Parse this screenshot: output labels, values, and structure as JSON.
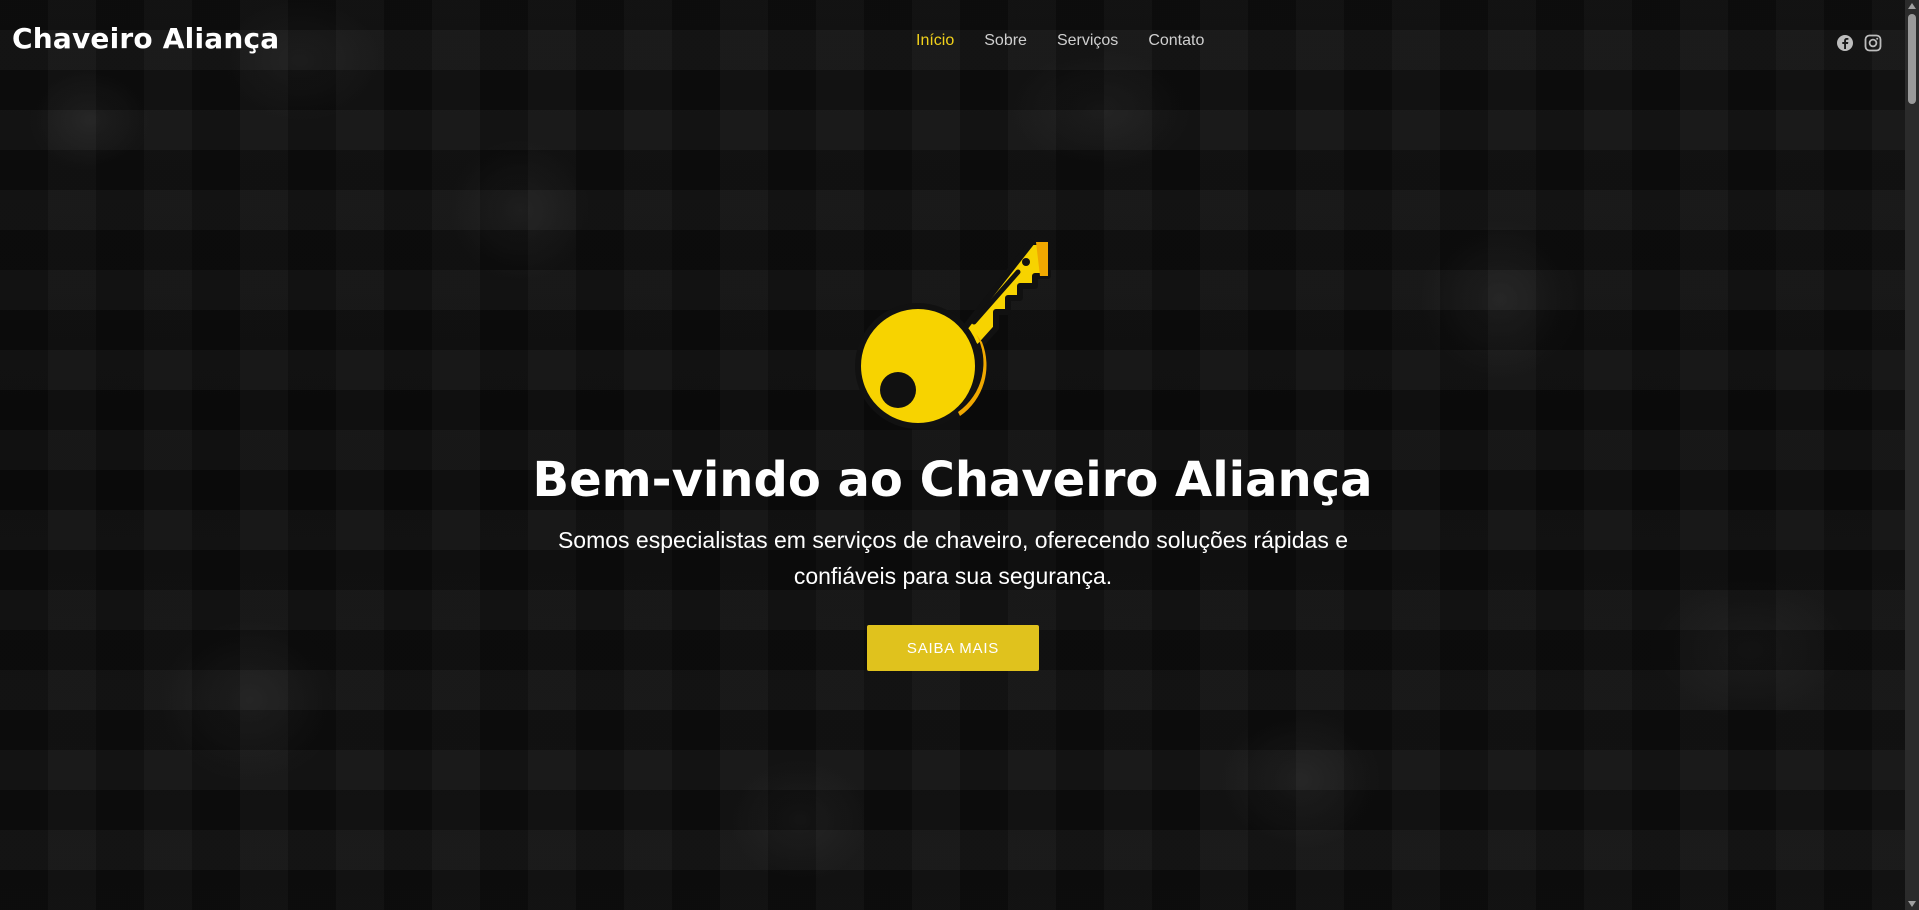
{
  "brand": {
    "name": "Chaveiro Aliança"
  },
  "nav": {
    "items": [
      {
        "label": "Início",
        "active": true
      },
      {
        "label": "Sobre",
        "active": false
      },
      {
        "label": "Serviços",
        "active": false
      },
      {
        "label": "Contato",
        "active": false
      }
    ]
  },
  "social": {
    "icons": [
      "facebook-icon",
      "instagram-icon"
    ]
  },
  "hero": {
    "icon": "key-icon",
    "title": "Bem-vindo ao Chaveiro Aliança",
    "subtitle": "Somos especialistas em serviços de chaveiro, oferecendo soluções rápidas e confiáveis para sua segurança.",
    "cta_label": "SAIBA MAIS"
  },
  "colors": {
    "accent": "#f2d21b",
    "button": "#e0c21d",
    "background": "#111111",
    "text": "#ffffff"
  }
}
